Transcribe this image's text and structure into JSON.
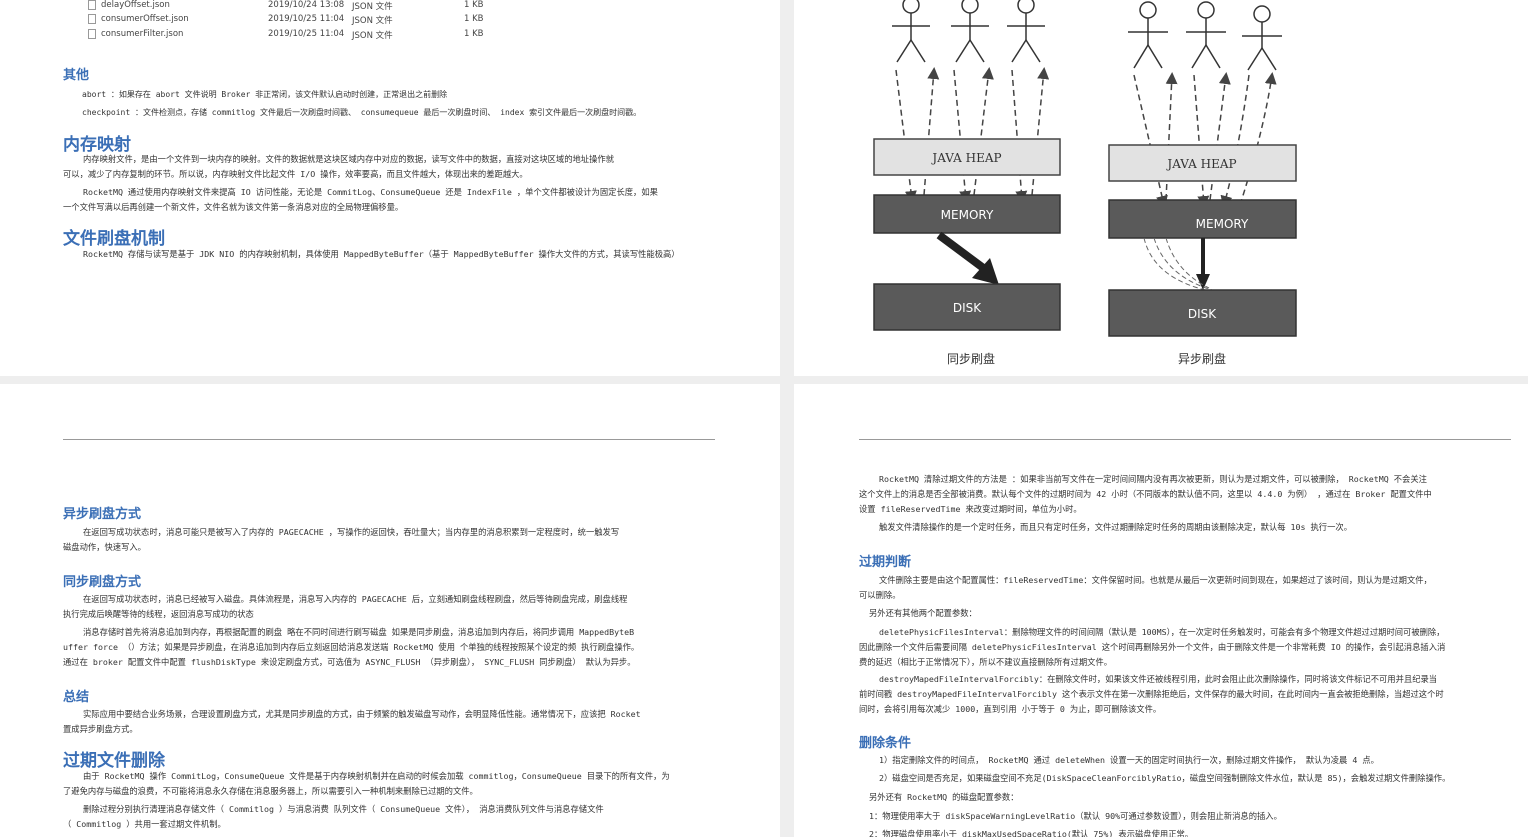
{
  "top_left": {
    "files": [
      {
        "name": "delayOffset.json",
        "date": "2019/10/24 13:08",
        "type": "JSON 文件",
        "size": "1 KB"
      },
      {
        "name": "consumerOffset.json",
        "date": "2019/10/25 11:04",
        "type": "JSON 文件",
        "size": "1 KB"
      },
      {
        "name": "consumerFilter.json",
        "date": "2019/10/25 11:04",
        "type": "JSON 文件",
        "size": "1 KB"
      }
    ],
    "other_heading": "其他",
    "abort_line": "abort ：如果存在 abort 文件说明 Broker 非正常闭，该文件默认启动时创建，正常退出之前删除",
    "checkpoint_line": "checkpoint ：文件检测点，存储 commitlog 文件最后一次刷盘时间戳、 consumequeue 最后一次刷盘时间、 index 索引文件最后一次刷盘时间戳。",
    "mmap_heading": "内存映射",
    "mmap_p1": "    内存映射文件，是由一个文件到一块内存的映射。文件的数据就是这块区域内存中对应的数据，读写文件中的数据，直接对这块区域的地址操作就\n可以，减少了内存复制的环节。所以说，内存映射文件比起文件 I/O 操作，效率要高，而且文件越大，体现出来的差距越大。",
    "mmap_p2": "    RocketMQ 通过使用内存映射文件来提高 IO 访问性能，无论是 CommitLog、ConsumeQueue 还是 IndexFile ，单个文件都被设计为固定长度，如果\n一个文件写满以后再创建一个新文件，文件名就为该文件第一条消息对应的全局物理偏移量。",
    "flush_heading": "文件刷盘机制",
    "flush_p1": "    RocketMQ 存储与读写是基于 JDK NIO 的内存映射机制，具体使用 MappedByteBuffer（基于 MappedByteBuffer 操作大文件的方式，其读写性能极高）"
  },
  "diagram": {
    "heap_label_left": "JAVA   HEAP",
    "heap_label_right": "JAVA HEAP",
    "memory_label": "MEMORY",
    "disk_label": "DISK",
    "caption_sync": "同步刷盘",
    "caption_async": "异步刷盘"
  },
  "bottom_left": {
    "async_heading": "异步刷盘方式",
    "async_p": "    在返回写成功状态时，消息可能只是被写入了内存的 PAGECACHE ，写操作的返回快，吞吐量大；当内存里的消息积累到一定程度时，统一触发写\n磁盘动作，快速写入。",
    "sync_heading": "同步刷盘方式",
    "sync_p1": "    在返回写成功状态时，消息已经被写入磁盘。具体流程是，消息写入内存的 PAGECACHE 后，立刻通知刷盘线程刷盘，然后等待刷盘完成，刷盘线程\n执行完成后唤醒等待的线程，返回消息写成功的状态",
    "sync_p2": "    消息存储时首先将消息追加到内存，再根据配置的刷盘 略在不同时间进行刷写磁盘 如果是同步刷盘，消息追加到内存后，将同步调用 MappedByteB\nuffer force （）方法；如果是异步刷盘，在消息追加到内存后立刻返回给消息发送端 RocketMQ 使用 个单独的线程按照某个设定的频 执行刷盘操作。\n通过在 broker 配置文件中配置 flushDiskType 来设定刷盘方式，可选值为 ASYNC_FLUSH （异步刷盘）， SYNC_FLUSH 同步刷盘） 默认为异步。",
    "summary_heading": "总结",
    "summary_p": "    实际应用中要结合业务场景，合理设置刷盘方式，尤其是同步刷盘的方式，由于频繁的触发磁盘写动作，会明显降低性能。通常情况下，应该把 Rocket\n置成异步刷盘方式。",
    "expire_heading": "过期文件删除",
    "expire_p1": "    由于 RocketMQ 操作 CommitLog，ConsumeQueue 文件是基于内存映射机制并在启动的时候会加载 commitlog，ConsumeQueue 目录下的所有文件，为\n了避免内存与磁盘的浪费，不可能将消息永久存储在消息服务器上，所以需要引入一种机制来删除已过期的文件。",
    "expire_p2": "    删除过程分别执行清理消息存储文件（ Commitlog ）与消息消费 队列文件（ ConsumeQueue 文件）， 消息消费队列文件与消息存储文件\n（ Commitlog ）共用一套过期文件机制。"
  },
  "bottom_right": {
    "p1": "    RocketMQ 清除过期文件的方法是 ：如果非当前写文件在一定时间间隔内没有再次被更新，则认为是过期文件，可以被删除， RocketMQ 不会关注\n这个文件上的消息是否全部被消费。默认每个文件的过期时间为 42 小时（不同版本的默认值不同，这里以 4.4.0 为例） ，通过在 Broker 配置文件中\n设置 fileReservedTime 来改变过期时间，单位为小时。",
    "p2": "    触发文件清除操作的是一个定时任务，而且只有定时任务，文件过期删除定时任务的周期由该删除决定，默认每 10s 执行一次。",
    "judge_heading": "过期判断",
    "judge_p1": "    文件删除主要是由这个配置属性：fileReservedTime：文件保留时间。也就是从最后一次更新时间到现在，如果超过了该时间，则认为是过期文件，\n可以删除。",
    "judge_p2": "  另外还有其他两个配置参数：",
    "judge_p3": "    deletePhysicFilesInterval：删除物理文件的时间间隔（默认是 100MS），在一次定时任务触发时，可能会有多个物理文件超过过期时间可被删除，\n因此删除一个文件后需要间隔 deletePhysicFilesInterval 这个时间再删除另外一个文件，由于删除文件是一个非常耗费 IO 的操作，会引起消息插入消\n费的延迟（相比于正常情况下），所以不建议直接删除所有过期文件。",
    "judge_p4": "    destroyMapedFileIntervalForcibly：在删除文件时，如果该文件还被线程引用，此时会阻止此次删除操作，同时将该文件标记不可用并且纪录当\n前时间戳 destroyMapedFileIntervalForcibly 这个表示文件在第一次删除拒绝后，文件保存的最大时间，在此时间内一直会被拒绝删除，当超过这个时\n间时，会将引用每次减少 1000，直到引用 小于等于 0 为止，即可删除该文件。",
    "cond_heading": "删除条件",
    "cond_p1": "    1）指定删除文件的时间点， RocketMQ 通过 deleteWhen 设置一天的固定时间执行一次，删除过期文件操作， 默认为凌晨 4 点。",
    "cond_p2": "    2）磁盘空间是否充足，如果磁盘空间不充足(DiskSpaceCleanForciblyRatio，磁盘空间强制删除文件水位，默认是 85)，会触发过期文件删除操作。",
    "cond_p3": "  另外还有 RocketMQ 的磁盘配置参数：",
    "cond_p4": "  1：物理使用率大于 diskSpaceWarningLevelRatio（默认 90%可通过参数设置），则会阻止新消息的插入。",
    "cond_p5": "  2：物理磁盘使用率小于 diskMaxUsedSpaceRatio(默认 75%) 表示磁盘使用正常。"
  }
}
